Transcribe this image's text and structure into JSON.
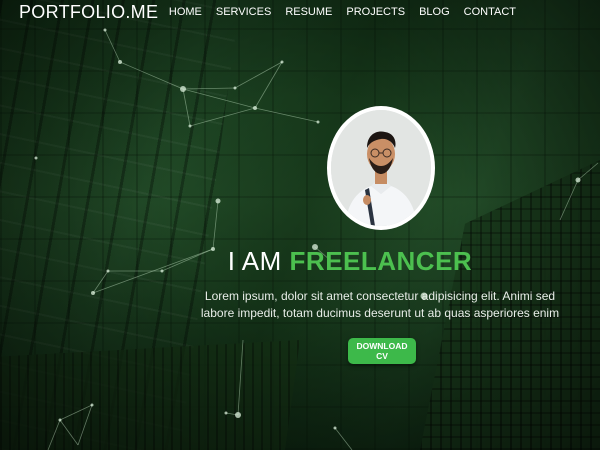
{
  "brand": {
    "logo": "PORTFOLIO.ME"
  },
  "nav": {
    "items": [
      {
        "label": "HOME"
      },
      {
        "label": "SERVICES"
      },
      {
        "label": "RESUME"
      },
      {
        "label": "PROJECTS"
      },
      {
        "label": "BLOG"
      },
      {
        "label": "CONTACT"
      }
    ]
  },
  "hero": {
    "headline_prefix": "I AM",
    "headline_accent": "FREELANCER",
    "intro": "Lorem ipsum, dolor sit amet consectetur adipisicing elit. Animi sed labore impedit, totam ducimus deserunt ut ab quas asperiores enim",
    "cta_label": "DOWNLOAD CV"
  },
  "colors": {
    "accent": "#4cc04f",
    "button": "#3db94a",
    "background": "#1c3d1f",
    "text": "#ffffff"
  },
  "icons": {
    "avatar": "profile-photo"
  }
}
